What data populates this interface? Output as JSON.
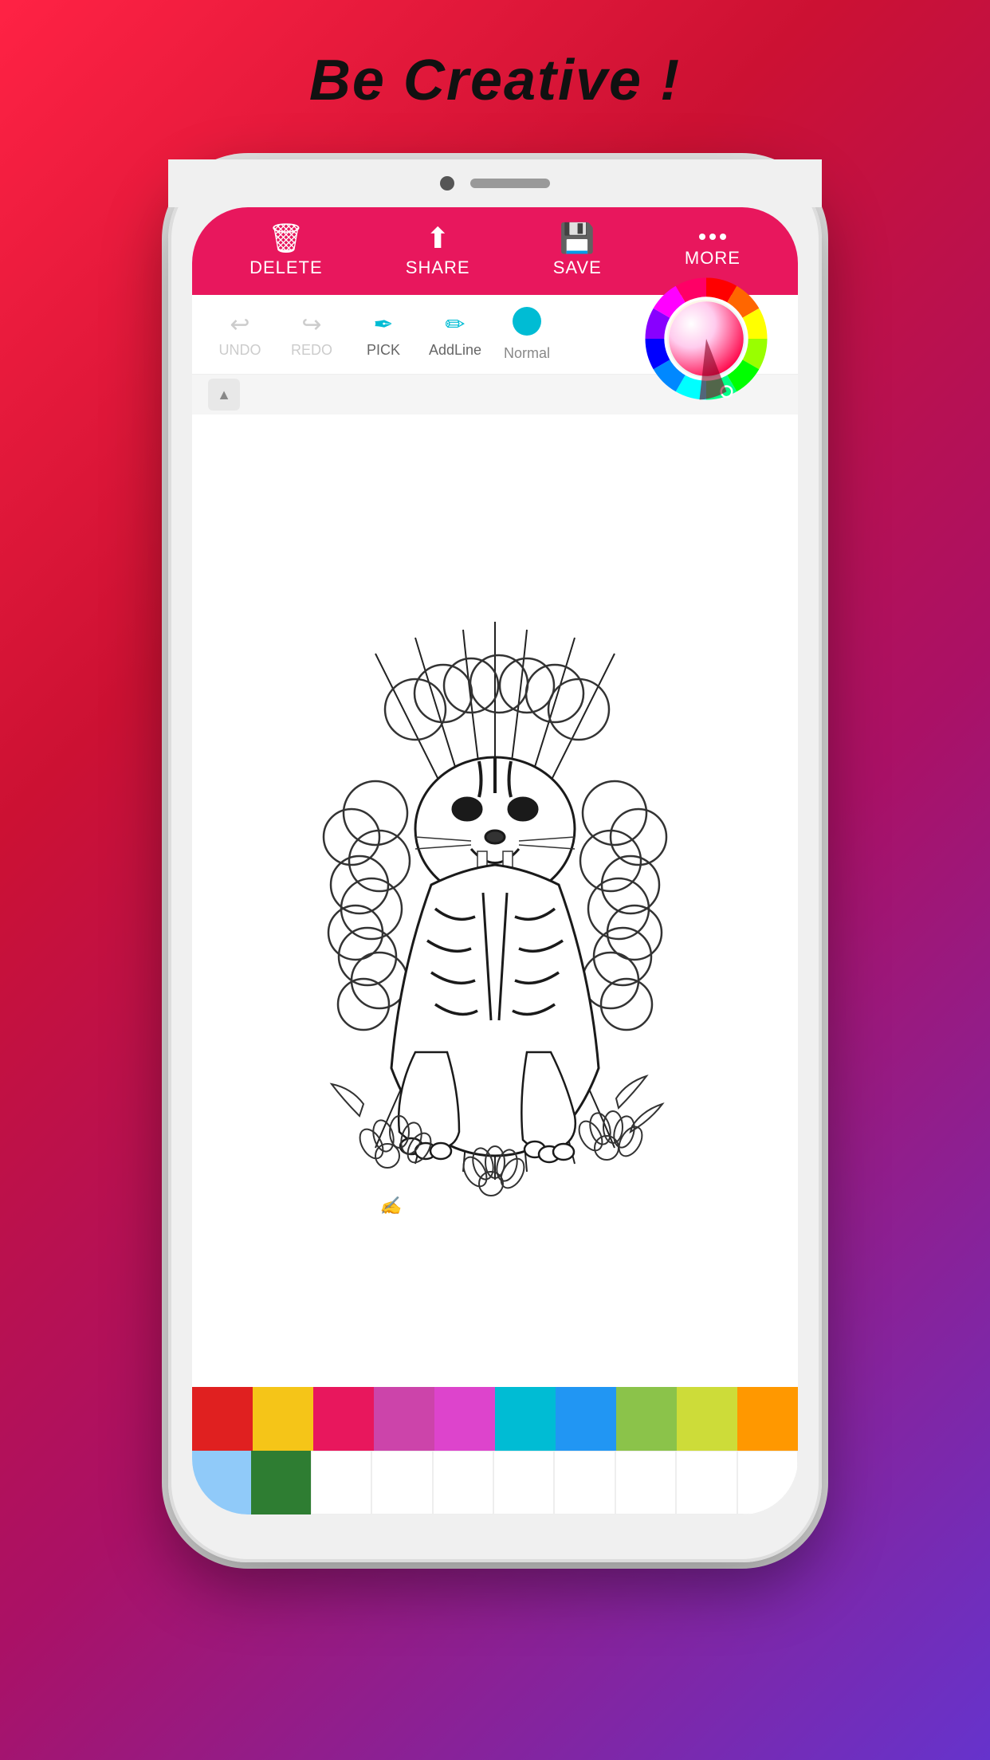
{
  "tagline": "Be Creative !",
  "toolbar": {
    "delete_label": "DELETE",
    "share_label": "SHARE",
    "save_label": "SAVE",
    "more_label": "MORE"
  },
  "subtoolbar": {
    "undo_label": "UNDO",
    "redo_label": "REDO",
    "pick_label": "PICK",
    "addline_label": "AddLine",
    "normal_label": "Normal"
  },
  "palette": {
    "row1": [
      "#e02020",
      "#f5c518",
      "#e8175d",
      "#cc44aa",
      "#dd44cc",
      "#00bcd4",
      "#2196f3",
      "#8bc34a",
      "#cddc39",
      "#ff9800"
    ],
    "row2": [
      "#64b5f6",
      "#81c784",
      "#388e3c",
      "#ffffff",
      "#ffffff",
      "#ffffff",
      "#ffffff",
      "#ffffff",
      "#ffffff",
      "#ffffff"
    ]
  }
}
